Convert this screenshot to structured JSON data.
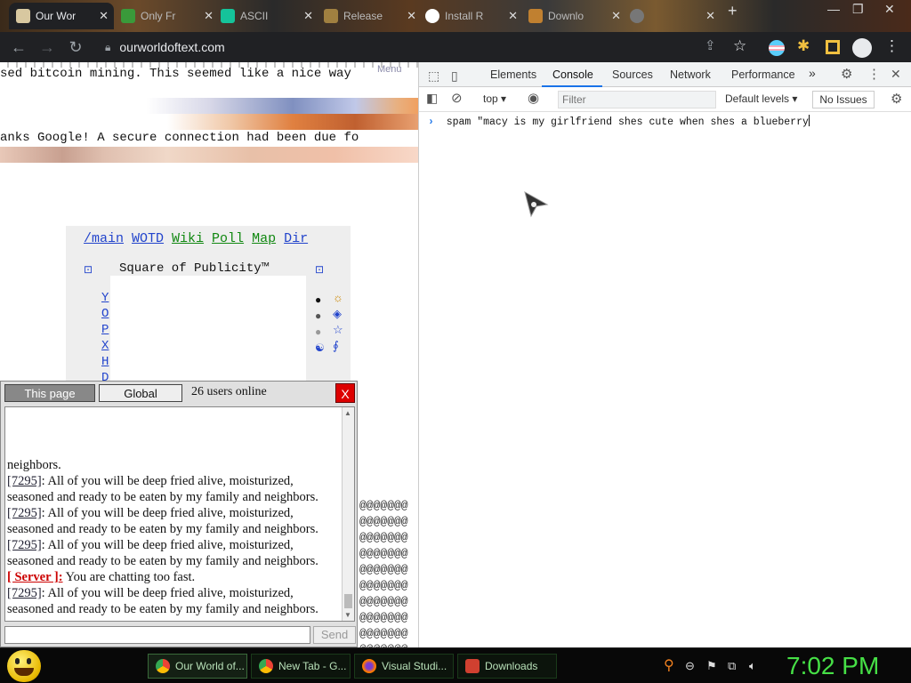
{
  "browser": {
    "tabs": [
      {
        "label": "Our Wor",
        "active": true
      },
      {
        "label": "Only Fr",
        "active": false
      },
      {
        "label": "ASCII",
        "active": false
      },
      {
        "label": "Release",
        "active": false
      },
      {
        "label": "Install R",
        "active": false
      },
      {
        "label": "Downlo",
        "active": false
      },
      {
        "label": "",
        "active": false
      }
    ],
    "new_tab": "+",
    "url": "ourworldoftext.com"
  },
  "page": {
    "line1": "sed bitcoin mining. This seemed like a nice way",
    "line2": "anks Google! A secure connection had been due fo",
    "menu": "Menu",
    "nav_links": [
      "/main",
      "WOTD",
      "Wiki",
      "Poll",
      "Map",
      "Dir"
    ],
    "publicity_title": "Square of Publicity™",
    "publicity_left": [
      "Y",
      "O",
      "P",
      "X",
      "H",
      "D"
    ],
    "publicity_dots": [
      "●",
      "●",
      "●",
      "☯"
    ],
    "publicity_symbols": [
      "☼",
      "◈",
      "☆",
      "∮"
    ],
    "at_rows": [
      "@@@@@@@",
      "@@@@@@@",
      "@@@@@@@",
      "@@@@@@@",
      "@@@@@@@",
      "@@@@@@@",
      "@@@@@@@",
      "@@@@@@@",
      "@@@@@@@",
      "@@@@@@@",
      "@@@@@@@",
      "@@@@@@@",
      "@@@@@@@"
    ]
  },
  "chat": {
    "tab_page": "This page",
    "tab_global": "Global",
    "online": "26 users online",
    "close": "X",
    "partial_top": "neighbors.",
    "messages": [
      {
        "nick": "[7295]",
        "server": false,
        "text": "All of you will be deep fried alive, moisturized, seasoned and ready to be eaten by my family and neighbors."
      },
      {
        "nick": "[7295]",
        "server": false,
        "text": "All of you will be deep fried alive, moisturized, seasoned and ready to be eaten by my family and neighbors."
      },
      {
        "nick": "[7295]",
        "server": false,
        "text": "All of you will be deep fried alive, moisturized, seasoned and ready to be eaten by my family and neighbors."
      },
      {
        "nick": "[ Server ]",
        "server": true,
        "text": "You are chatting too fast."
      },
      {
        "nick": "[7295]",
        "server": false,
        "text": "All of you will be deep fried alive, moisturized, seasoned and ready to be eaten by my family and neighbors."
      }
    ],
    "send": "Send",
    "input_value": ""
  },
  "devtools": {
    "tabs": [
      "Elements",
      "Console",
      "Sources",
      "Network",
      "Performance"
    ],
    "active_tab": "Console",
    "more": "»",
    "context": "top",
    "filter_placeholder": "Filter",
    "levels": "Default levels",
    "issues": "No Issues",
    "prompt": "›",
    "input": "spam \"macy is my girlfriend shes cute when shes a blueberry"
  },
  "taskbar": {
    "tasks": [
      "Our World of...",
      "New Tab - G...",
      "Visual Studi...",
      "Downloads"
    ],
    "clock": "7:02 PM"
  },
  "colors": {
    "devtools_accent": "#1a73e8",
    "clock_green": "#46e046",
    "server_red": "#cc0000",
    "link_blue": "#2244cc",
    "link_green": "#118811"
  }
}
